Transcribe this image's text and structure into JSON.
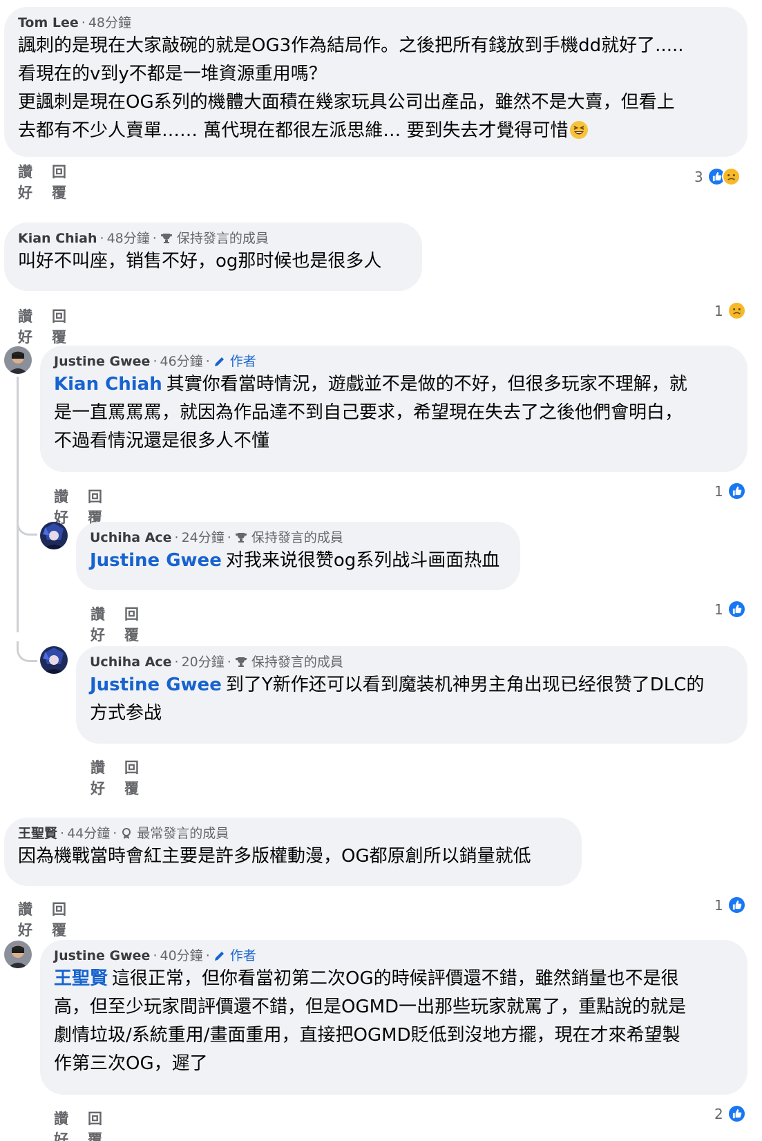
{
  "comments": [
    {
      "author": "Tom Lee",
      "time": "48分鐘",
      "badge": "",
      "mention": "",
      "lines": [
        "諷刺的是現在大家敲碗的就是OG3作為結局作。之後把所有錢放到手機dd就好了.....",
        "看現在的v到y不都是一堆資源重用嗎？",
        "更諷刺是現在OG系列的機體大面積在幾家玩具公司出產品，雖然不是大賣，但看上",
        "去都有不少人賣單…… 萬代現在都很左派思維… 要到失去才覺得可惜"
      ],
      "like_label": "讚好",
      "reply_label": "回覆",
      "reaction_count": "3",
      "reactions": [
        "like-icon",
        "sad-icon"
      ],
      "trailing_emoji": "grinning-squinting-face-icon"
    },
    {
      "author": "Kian  Chiah",
      "time": "48分鐘",
      "badge": "保持發言的成員",
      "mention": "",
      "lines": [
        "叫好不叫座，销售不好，og那时候也是很多人"
      ],
      "like_label": "讚好",
      "reply_label": "回覆",
      "reaction_count": "1",
      "reactions": [
        "sad-icon"
      ]
    },
    {
      "author": "Justine Gwee",
      "time": "46分鐘",
      "badge": "作者",
      "mention": "Kian  Chiah",
      "lines": [
        "其實你看當時情況，遊戲並不是做的不好，但很多玩家不理解，就",
        "是一直罵罵罵，就因為作品達不到自己要求，希望現在失去了之後他們會明白，",
        "不過看情況還是很多人不懂"
      ],
      "like_label": "讚好",
      "reply_label": "回覆",
      "reaction_count": "1",
      "reactions": [
        "like-icon"
      ]
    },
    {
      "author": "Uchiha Ace",
      "time": "24分鐘",
      "badge": "保持發言的成員",
      "mention": "Justine Gwee",
      "lines": [
        "对我来说很赞og系列战斗画面热血"
      ],
      "like_label": "讚好",
      "reply_label": "回覆",
      "reaction_count": "1",
      "reactions": [
        "like-icon"
      ]
    },
    {
      "author": "Uchiha Ace",
      "time": "20分鐘",
      "badge": "保持發言的成員",
      "mention": "Justine Gwee",
      "lines": [
        "到了Y新作还可以看到魔装机神男主角出现已经很赞了DLC的",
        "方式参战"
      ],
      "like_label": "讚好",
      "reply_label": "回覆",
      "reaction_count": "",
      "reactions": []
    },
    {
      "author": "王聖賢",
      "time": "44分鐘",
      "badge": "最常發言的成員",
      "mention": "",
      "lines": [
        "因為機戰當時會紅主要是許多版權動漫，OG都原創所以銷量就低"
      ],
      "like_label": "讚好",
      "reply_label": "回覆",
      "reaction_count": "1",
      "reactions": [
        "like-icon"
      ]
    },
    {
      "author": "Justine Gwee",
      "time": "40分鐘",
      "badge": "作者",
      "mention": "王聖賢",
      "lines": [
        "這很正常，但你看當初第二次OG的時候評價還不錯，雖然銷量也不是很",
        "高，但至少玩家間評價還不錯，但是OGMD一出那些玩家就罵了，重點說的就是",
        "劇情垃圾/系統重用/畫面重用，直接把OGMD貶低到沒地方擺，現在才來希望製",
        "作第三次OG，遲了"
      ],
      "like_label": "讚好",
      "reply_label": "回覆",
      "reaction_count": "2",
      "reactions": [
        "like-icon"
      ]
    }
  ],
  "colors": {
    "bubble_bg": "#f0f2f5",
    "mention_blue": "#1763cf",
    "like_blue": "#1877f2",
    "sad_yellow": "#f7b928",
    "meta_gray": "#65676b"
  }
}
